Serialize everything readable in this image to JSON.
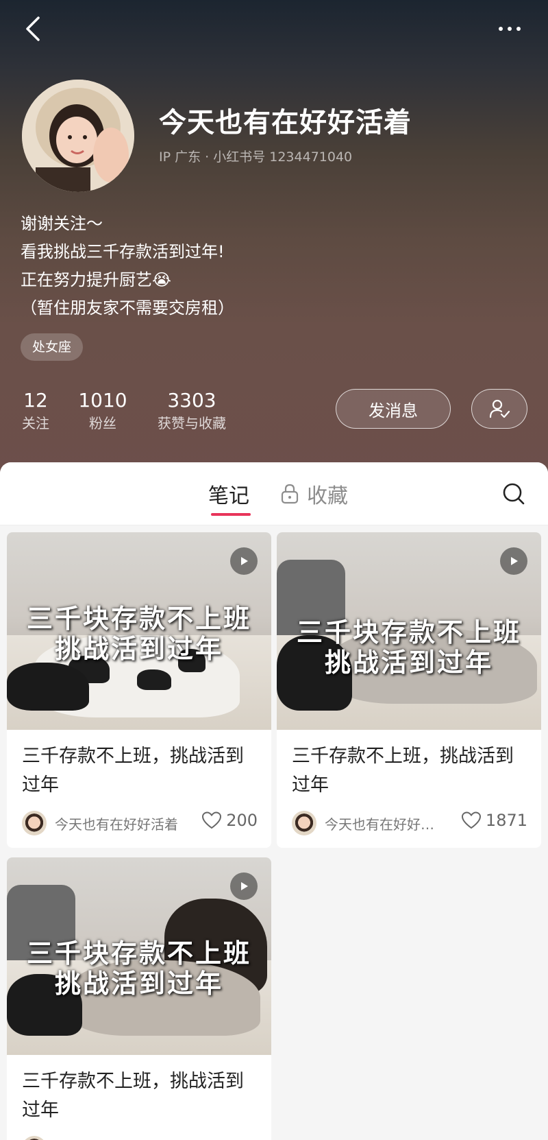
{
  "profile": {
    "name": "今天也有在好好活着",
    "ip_line": "IP 广东 · 小红书号 1234471040",
    "bio": [
      "谢谢关注～",
      "看我挑战三千存款活到过年!",
      "正在努力提升厨艺😭",
      "（暂住朋友家不需要交房租）"
    ],
    "tag": "处女座",
    "stats": {
      "following": {
        "value": "12",
        "label": "关注"
      },
      "followers": {
        "value": "1010",
        "label": "粉丝"
      },
      "likes_collects": {
        "value": "3303",
        "label": "获赞与收藏"
      }
    },
    "message_button": "发消息"
  },
  "tabs": {
    "notes": "笔记",
    "collections": "收藏"
  },
  "notes": [
    {
      "overlay_line1": "三千块存款不上班",
      "overlay_line2": "挑战活到过年",
      "title": "三千存款不上班，挑战活到过年",
      "author": "今天也有在好好活着",
      "likes": "200"
    },
    {
      "overlay_line1": "三千块存款不上班",
      "overlay_line2": "挑战活到过年",
      "title": "三千存款不上班，挑战活到过年",
      "author": "今天也有在好好…",
      "likes": "1871"
    },
    {
      "overlay_line1": "三千块存款不上班",
      "overlay_line2": "挑战活到过年",
      "title": "三千存款不上班，挑战活到过年"
    }
  ],
  "colors": {
    "accent": "#e8345a",
    "header_top": "#1c2530",
    "header_bottom": "#6d4f4b"
  }
}
